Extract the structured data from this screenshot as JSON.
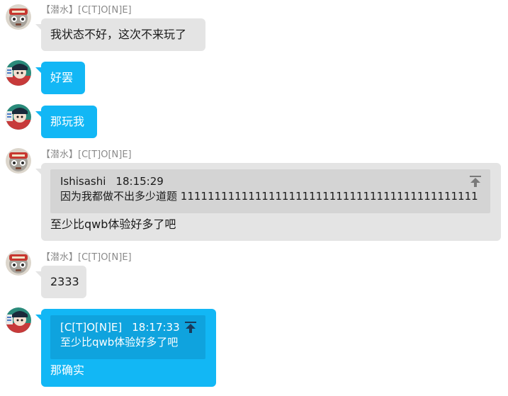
{
  "messages": [
    {
      "sender": "【潜水】[C[T]O[N]E]",
      "text": "我状态不好，这次不来玩了"
    },
    {
      "text": "好罢"
    },
    {
      "text": "那玩我"
    },
    {
      "sender": "【潜水】[C[T]O[N]E]",
      "quote": {
        "author": "Ishisashi",
        "time": "18:15:29",
        "text": "因为我都做不出多少道题 11111111111111111111111111111111111111111111"
      },
      "text": "至少比qwb体验好多了吧"
    },
    {
      "sender": "【潜水】[C[T]O[N]E]",
      "text": "2333"
    },
    {
      "quote": {
        "author": "[C[T]O[N]E]",
        "time": "18:17:33",
        "text": "至少比qwb体验好多了吧"
      },
      "text": "那确实"
    }
  ],
  "icons": {
    "quote_jump": "jump-to-top-icon",
    "avatar_left": "cat-avatar",
    "avatar_right": "character-avatar"
  },
  "colors": {
    "gray_bubble": "#e4e4e4",
    "blue_bubble": "#12b7f5",
    "quote_gray": "#d4d4d4",
    "quote_blue": "#0fa3de",
    "sender": "#8a8a8a"
  }
}
